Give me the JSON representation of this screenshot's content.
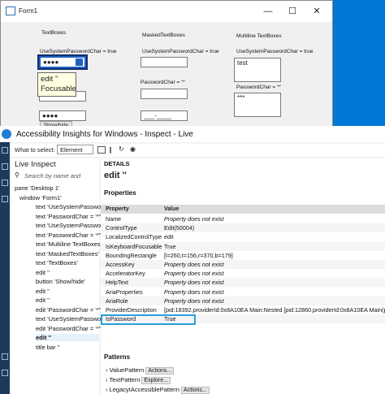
{
  "form1": {
    "title": "Form1",
    "controls": {
      "min": "—",
      "max": "☐",
      "close": "✕"
    },
    "col1_header": "TextBoxes",
    "col2_header": "MaskedTextBoxes",
    "col3_header": "Multiline TextBoxes",
    "use_sys_pwd": "UseSystemPasswordChar = true",
    "pwd_char": "PasswordChar = '*'",
    "tb1_value": "●●●●",
    "tb_masked1_value": "",
    "tb_multi1_value": "test",
    "tb_masked2_value": "",
    "tb_multi2_value": "***",
    "tb_col1_row3": "",
    "tb_col1_row4": "●●●●",
    "tb_masked3_value": "___-____",
    "show_hide": "Show/hide",
    "tooltip_line1": "edit ''",
    "tooltip_line2": "Focusable"
  },
  "inspect": {
    "title": "Accessibility Insights for Windows - Inspect - Live",
    "what_to_select": "What to select:",
    "select_value": "Element",
    "live_inspect": "Live Inspect",
    "search_placeholder": "Search by name and",
    "tree": [
      "pane 'Desktop 1'",
      "window 'Form1'",
      "text 'UseSystemPassword",
      "text 'PasswordChar = '*''",
      "text 'UseSystemPassword",
      "text 'PasswordChar = '*''",
      "text 'Multiline TextBoxes'",
      "text 'MaskedTextBoxes'",
      "text 'TextBoxes'",
      "edit ''",
      "button 'Show/hide'",
      "edit ''",
      "edit ''",
      "edit 'PasswordChar = '*''",
      "text 'UseSystemPassword",
      "edit 'PasswordChar = '*''",
      "edit ''",
      "title bar ''"
    ],
    "details_tab": "DETAILS",
    "element_title": "edit ''",
    "properties_header": "Properties",
    "col_property": "Property",
    "col_value": "Value",
    "properties": [
      {
        "n": "Name",
        "v": "Property does not exist",
        "i": true
      },
      {
        "n": "ControlType",
        "v": "Edit(50004)",
        "i": false
      },
      {
        "n": "LocalizedControlType",
        "v": "edit",
        "i": false
      },
      {
        "n": "IsKeyboardFocusable",
        "v": "True",
        "i": false
      },
      {
        "n": "BoundingRectangle",
        "v": "[l=260,t=156,r=370,b=179]",
        "i": false
      },
      {
        "n": "AccessKey",
        "v": "Property does not exist",
        "i": true
      },
      {
        "n": "AcceleratorKey",
        "v": "Property does not exist",
        "i": true
      },
      {
        "n": "HelpText",
        "v": "Property does not exist",
        "i": true
      },
      {
        "n": "AriaProperties",
        "v": "Property does not exist",
        "i": true
      },
      {
        "n": "AriaRole",
        "v": "Property does not exist",
        "i": true
      },
      {
        "n": "ProviderDescription",
        "v": "[pid:18392,providerId:0x8A10EA Main:Nested [pid:12860,providerId:0x8A10EA Main(pa",
        "i": false
      },
      {
        "n": "IsPassword",
        "v": "True",
        "i": false
      }
    ],
    "patterns_header": "Patterns",
    "patterns": [
      {
        "name": "ValuePattern",
        "action": "Actions..."
      },
      {
        "name": "TextPattern",
        "action": "Explore..."
      },
      {
        "name": "LegacyIAccessiblePattern",
        "action": "Actions..."
      }
    ],
    "colors": {
      "accent": "#0078d7",
      "highlight": "#28a0d8"
    }
  }
}
